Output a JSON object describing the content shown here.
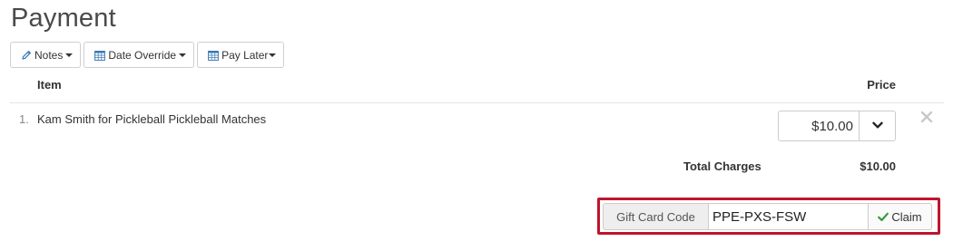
{
  "page": {
    "title": "Payment"
  },
  "toolbar": {
    "notes_label": "Notes",
    "date_override_label": "Date Override",
    "pay_later_label": "Pay Later",
    "icon_color": "#3a78b5"
  },
  "table": {
    "headers": {
      "item": "Item",
      "price": "Price"
    },
    "rows": [
      {
        "num": "1.",
        "item": "Kam Smith for Pickleball Pickleball Matches",
        "price": "$10.00"
      }
    ]
  },
  "totals": {
    "label": "Total Charges",
    "value": "$10.00"
  },
  "gift_card": {
    "addon_label": "Gift Card Code",
    "value": "PPE-PXS-FSW",
    "claim_label": "Claim",
    "highlight_color": "#c0142c",
    "claim_icon_color": "#3a9a3a"
  },
  "icons": {
    "notes": "pencil-icon",
    "date_override": "calendar-icon",
    "pay_later": "calendar-icon",
    "price_dropdown": "chevron-down-icon",
    "remove": "close-icon",
    "claim": "checkmark-icon"
  }
}
